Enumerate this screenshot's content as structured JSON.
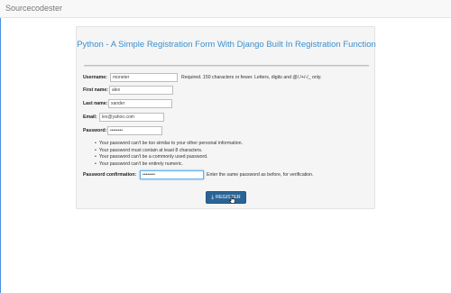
{
  "navbar": {
    "brand": "Sourcecodester"
  },
  "form": {
    "title": "Python - A Simple Registration Form With Django Built In Registration Function",
    "username": {
      "label": "Username:",
      "value": "moneter",
      "help": "Required. 150 characters or fewer. Letters, digits and @/./+/-/_ only."
    },
    "first_name": {
      "label": "First name:",
      "value": "alex"
    },
    "last_name": {
      "label": "Last name:",
      "value": "xander"
    },
    "email": {
      "label": "Email:",
      "value": "lex@yahoo.com"
    },
    "password": {
      "label": "Password:",
      "value": "••••••••"
    },
    "password_rules": [
      "Your password can't be too similar to your other personal information.",
      "Your password must contain at least 8 characters.",
      "Your password can't be a commonly used password.",
      "Your password can't be entirely numeric."
    ],
    "password_confirmation": {
      "label": "Password confirmation:",
      "value": "••••••••",
      "help": "Enter the same password as before, for verification."
    },
    "submit": {
      "label": "REGISTER",
      "icon": "download-icon"
    }
  }
}
